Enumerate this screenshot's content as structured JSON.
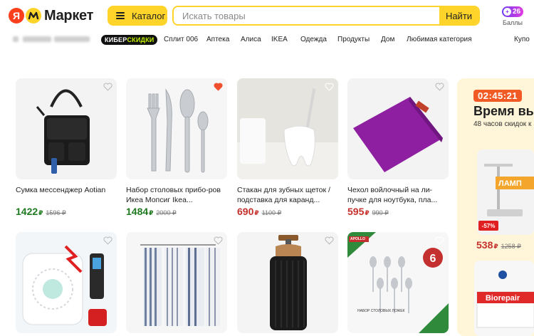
{
  "header": {
    "logo_ya": "Я",
    "logo_text": "Маркет",
    "catalog_label": "Каталог",
    "search_placeholder": "Искать товары",
    "search_button": "Найти",
    "points_count": "26",
    "points_label": "Баллы"
  },
  "nav": {
    "promo_part1": "КИБЕР",
    "promo_part2": "СКИДКИ",
    "links": [
      "Сплит 006",
      "Аптека",
      "Алиса",
      "IKEA",
      "Одежда",
      "Продукты",
      "Дом",
      "Любимая категория",
      "Купо"
    ]
  },
  "products": [
    {
      "title": "Сумка мессенджер Aotian",
      "price": "1422",
      "currency": "₽",
      "old_price": "1596 ₽",
      "price_color": "green",
      "favorite": false,
      "icon": "messenger-bag"
    },
    {
      "title": "Набор столовых прибо-ров Икеа Мопсиг Ikea...",
      "price": "1484",
      "currency": "₽",
      "old_price": "2000 ₽",
      "price_color": "green",
      "favorite": true,
      "icon": "cutlery-set"
    },
    {
      "title": "Стакан для зубных щеток / подставка для каранд...",
      "price": "690",
      "currency": "₽",
      "old_price": "1100 ₽",
      "price_color": "red",
      "favorite": false,
      "icon": "tooth-holder"
    },
    {
      "title": "Чехол войлочный на ли-пучке для ноутбука, пла...",
      "price": "595",
      "currency": "₽",
      "old_price": "990 ₽",
      "price_color": "red",
      "favorite": false,
      "icon": "felt-laptop-case"
    },
    {
      "title": "",
      "price": "",
      "currency": "",
      "old_price": "",
      "favorite": false,
      "icon": "smoke-detector"
    },
    {
      "title": "",
      "price": "",
      "currency": "",
      "old_price": "",
      "favorite": false,
      "icon": "kitchen-towels"
    },
    {
      "title": "",
      "price": "",
      "currency": "",
      "old_price": "",
      "favorite": false,
      "icon": "soap-dispenser"
    },
    {
      "title": "",
      "price": "",
      "currency": "",
      "old_price": "",
      "favorite": false,
      "icon": "spoon-set",
      "brand": "APOLLO",
      "badge": "6",
      "caption": "НАБОР СТОЛОВЫХ ЛОЖЕК"
    }
  ],
  "promo": {
    "timer": "02:45:21",
    "title": "Время вы",
    "subtitle": "48 часов скидок к",
    "discount": "-57%",
    "lamp_text": "ЛАМП",
    "price": "538",
    "currency": "₽",
    "old_price": "1258 ₽",
    "brand2": "Biorepair"
  },
  "colors": {
    "accent": "#fed42b",
    "green_price": "#1f7a1f",
    "red_price": "#c4312c",
    "timer": "#f15a24",
    "favorite": "#f0502f"
  }
}
